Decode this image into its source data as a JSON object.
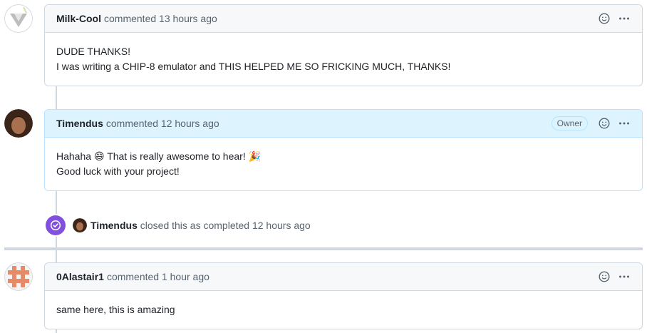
{
  "comments": [
    {
      "author": "Milk-Cool",
      "meta": "commented 13 hours ago",
      "lines": [
        "DUDE THANKS!",
        "I was writing a CHIP-8 emulator and THIS HELPED ME SO FRICKING MUCH, THANKS!"
      ]
    },
    {
      "author": "Timendus",
      "meta": "commented 12 hours ago",
      "badge": "Owner",
      "line1_a": "Hahaha",
      "line1_emoji": "😄",
      "line1_b": "That is really awesome to hear!",
      "line1_emoji2": "🎉",
      "line2": "Good luck with your project!"
    },
    {
      "author": "0Alastair1",
      "meta": "commented 1 hour ago",
      "lines": [
        "same here, this is amazing"
      ]
    }
  ],
  "event": {
    "actor": "Timendus",
    "text": "closed this as completed 12 hours ago",
    "icon": "check-circle-icon",
    "color": "#8250df"
  },
  "icons": {
    "reaction": "smiley-icon",
    "menu": "kebab-horizontal-icon"
  }
}
